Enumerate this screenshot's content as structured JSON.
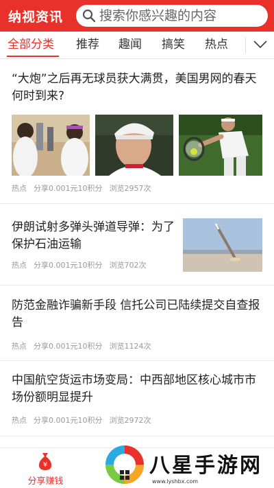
{
  "header": {
    "app_title": "纳视资讯",
    "search_placeholder": "搜索你感兴趣的内容"
  },
  "tabs": [
    {
      "label": "全部分类",
      "active": true
    },
    {
      "label": "推荐",
      "active": false
    },
    {
      "label": "趣闻",
      "active": false
    },
    {
      "label": "搞笑",
      "active": false
    },
    {
      "label": "热点",
      "active": false
    }
  ],
  "articles": [
    {
      "title": "“大炮”之后再无球员获大满贯，美国男网的春天何时到来?",
      "category": "热点",
      "share": "分享0.001元10积分",
      "views": "浏览2957次"
    },
    {
      "title": "伊朗试射多弹头弹道导弹：为了保护石油运输",
      "category": "热点",
      "share": "分享0.001元10积分",
      "views": "浏览702次"
    },
    {
      "title": "防范金融诈骗新手段 信托公司已陆续提交自查报告",
      "category": "热点",
      "share": "分享0.001元10积分",
      "views": "浏览1124次"
    },
    {
      "title": "中国航空货运市场变局：中西部地区核心城市市场份额明显提升",
      "category": "热点",
      "share": "分享0.001元10积分",
      "views": "浏览2972次"
    }
  ],
  "bottom_nav": {
    "share_label": "分享赚钱",
    "coin_symbol": "¥"
  },
  "watermark": {
    "text": "八星手游网",
    "url": "www.lyshbx.com"
  },
  "colors": {
    "brand_red": "#e8312a",
    "meta_gray": "#999999"
  }
}
